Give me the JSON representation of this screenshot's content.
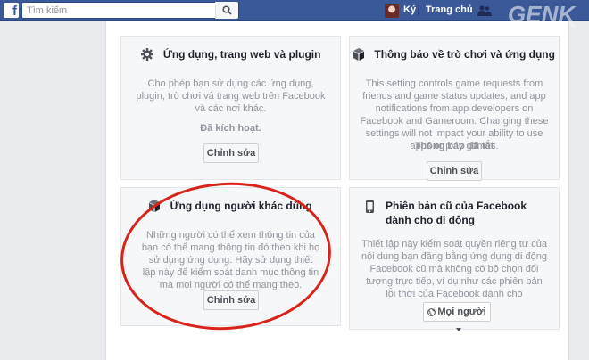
{
  "topbar": {
    "search_placeholder": "Tìm kiếm",
    "profile_name": "Ký",
    "home_label": "Trang chủ"
  },
  "watermark": {
    "text": "GENK",
    "sub": "GENK.VN"
  },
  "cards": {
    "apps": {
      "title": "Ứng dụng, trang web và plugin",
      "icon": "gear-icon",
      "description": "Cho phép bạn sử dụng các ứng dụng, plugin, trò chơi và trang web trên Facebook và các nơi khác.",
      "status": "Đã kích hoạt.",
      "button": "Chỉnh sửa"
    },
    "game_notifications": {
      "title": "Thông báo về trò chơi và ứng dụng",
      "icon": "cube-icon",
      "description": "This setting controls game requests from friends and game status updates, and app notifications from app developers on Facebook and Gameroom. Changing these settings will not impact your ability to use apps or play games.",
      "status": "Thông báo đã tắt",
      "button": "Chỉnh sửa"
    },
    "apps_others_use": {
      "title": "Ứng dụng người khác dùng",
      "icon": "cube-icon",
      "description": "Những người có thể xem thông tin của bạn có thể mang thông tin đó theo khi họ sử dụng ứng dụng. Hãy sử dụng thiết lập này để kiểm soát danh mục thông tin mà mọi người có thể mang theo.",
      "button": "Chỉnh sửa"
    },
    "old_mobile": {
      "title": "Phiên bản cũ của Facebook dành cho di động",
      "icon": "mobile-phone-icon",
      "description": "Thiết lập này kiểm soát quyền riêng tư của nội dung bạn đăng bằng ứng dụng di động Facebook cũ mà không có bộ chọn đối tượng trực tiếp, ví dụ như các phiên bản lỗi thời của Facebook dành cho Blackberry.",
      "button": "Mọi người"
    }
  },
  "colors": {
    "topbar": "#3b5998",
    "annotation": "#d8231b"
  }
}
